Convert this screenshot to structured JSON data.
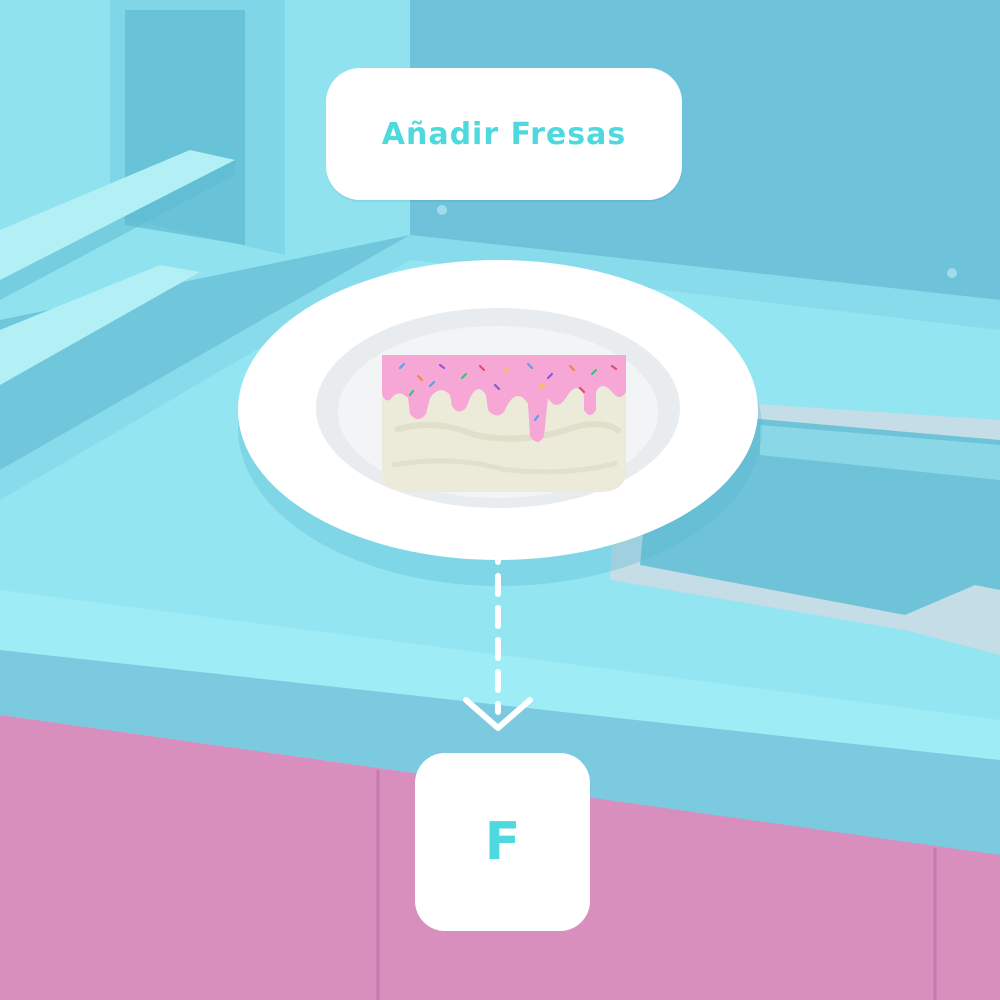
{
  "instruction": {
    "text": "Añadir Fresas"
  },
  "key_prompt": {
    "key": "F"
  },
  "colors": {
    "wall": "#6fc6dc",
    "counter_top": "#9ae9f2",
    "counter_front": "#79c7e0",
    "cabinet": "#d98fbd",
    "frosting": "#f7a8d8",
    "cake": "#eeeede",
    "accent_text": "#4dd9de"
  },
  "icons": [
    "dashed-arrow-down-icon",
    "sprinkles-icon"
  ]
}
